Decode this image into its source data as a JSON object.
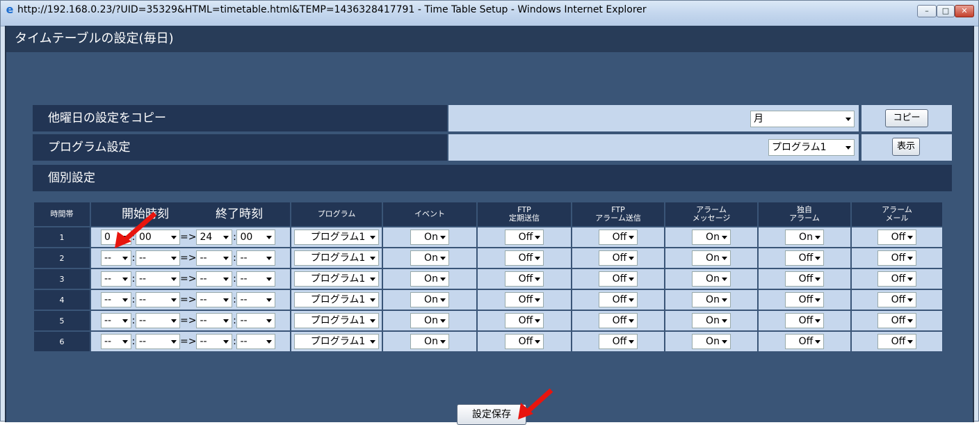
{
  "window": {
    "title": "http://192.168.0.23/?UID=35329&HTML=timetable.html&TEMP=1436328417791 - Time Table Setup - Windows Internet Explorer",
    "min_label": "–",
    "max_label": "□",
    "close_label": "✕"
  },
  "page": {
    "title": "タイムテーブルの設定(毎日)"
  },
  "copy_row": {
    "label": "他曜日の設定をコピー",
    "select_value": "月",
    "button_label": "コピー"
  },
  "program_row": {
    "label": "プログラム設定",
    "select_value": "プログラム1",
    "button_label": "表示"
  },
  "individual_row": {
    "label": "個別設定"
  },
  "table": {
    "headers": {
      "slot": "時間帯",
      "start": "開始時刻",
      "end": "終了時刻",
      "program": "プログラム",
      "event": "イベント",
      "ftp_periodic_1": "FTP",
      "ftp_periodic_2": "定期送信",
      "ftp_alarm_1": "FTP",
      "ftp_alarm_2": "アラーム送信",
      "alarm_msg_1": "アラーム",
      "alarm_msg_2": "メッセージ",
      "own_alarm_1": "独自",
      "own_alarm_2": "アラーム",
      "alarm_mail_1": "アラーム",
      "alarm_mail_2": "メール"
    },
    "arrow_text": "=>",
    "colon": ":",
    "rows": [
      {
        "num": "1",
        "sh": "0",
        "sm": "00",
        "eh": "24",
        "em": "00",
        "program": "プログラム1",
        "event": "On",
        "ftp_periodic": "Off",
        "ftp_alarm": "Off",
        "alarm_msg": "On",
        "own_alarm": "On",
        "alarm_mail": "Off"
      },
      {
        "num": "2",
        "sh": "--",
        "sm": "--",
        "eh": "--",
        "em": "--",
        "program": "プログラム1",
        "event": "On",
        "ftp_periodic": "Off",
        "ftp_alarm": "Off",
        "alarm_msg": "On",
        "own_alarm": "Off",
        "alarm_mail": "Off"
      },
      {
        "num": "3",
        "sh": "--",
        "sm": "--",
        "eh": "--",
        "em": "--",
        "program": "プログラム1",
        "event": "On",
        "ftp_periodic": "Off",
        "ftp_alarm": "Off",
        "alarm_msg": "On",
        "own_alarm": "Off",
        "alarm_mail": "Off"
      },
      {
        "num": "4",
        "sh": "--",
        "sm": "--",
        "eh": "--",
        "em": "--",
        "program": "プログラム1",
        "event": "On",
        "ftp_periodic": "Off",
        "ftp_alarm": "Off",
        "alarm_msg": "On",
        "own_alarm": "Off",
        "alarm_mail": "Off"
      },
      {
        "num": "5",
        "sh": "--",
        "sm": "--",
        "eh": "--",
        "em": "--",
        "program": "プログラム1",
        "event": "On",
        "ftp_periodic": "Off",
        "ftp_alarm": "Off",
        "alarm_msg": "On",
        "own_alarm": "Off",
        "alarm_mail": "Off"
      },
      {
        "num": "6",
        "sh": "--",
        "sm": "--",
        "eh": "--",
        "em": "--",
        "program": "プログラム1",
        "event": "On",
        "ftp_periodic": "Off",
        "ftp_alarm": "Off",
        "alarm_msg": "On",
        "own_alarm": "Off",
        "alarm_mail": "Off"
      }
    ]
  },
  "save_button": {
    "label": "設定保存"
  },
  "colors": {
    "content_bg": "#3a5577",
    "header_dark": "#223554",
    "value_cell": "#c6d7ed",
    "annotation_red": "#e8150e"
  }
}
